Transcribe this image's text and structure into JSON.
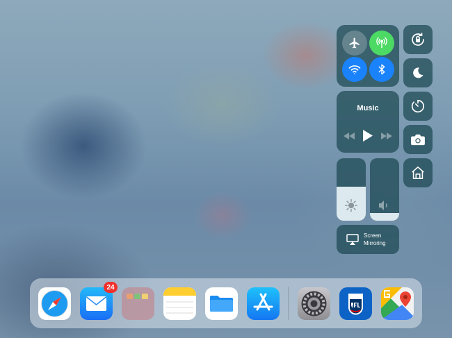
{
  "control_center": {
    "connectivity": {
      "airplane": {
        "icon": "airplane-icon",
        "state": "off"
      },
      "cellular": {
        "icon": "antenna-icon",
        "state": "on",
        "color": "#4cd964"
      },
      "wifi": {
        "icon": "wifi-icon",
        "state": "on",
        "color": "#1a82fb"
      },
      "bluetooth": {
        "icon": "bluetooth-icon",
        "state": "on",
        "color": "#1a82fb"
      }
    },
    "music": {
      "title": "Music",
      "controls": [
        "rewind-icon",
        "play-icon",
        "fast-forward-icon"
      ]
    },
    "brightness": {
      "icon": "sun-icon",
      "level": 0.55
    },
    "volume": {
      "icon": "speaker-icon",
      "level": 0.12
    },
    "screen_mirroring": {
      "label_line1": "Screen",
      "label_line2": "Mirroring",
      "icon": "airplay-icon"
    },
    "side_buttons": [
      {
        "name": "rotation-lock",
        "icon": "rotation-lock-icon"
      },
      {
        "name": "do-not-disturb",
        "icon": "moon-icon"
      },
      {
        "name": "timer",
        "icon": "timer-icon"
      },
      {
        "name": "camera",
        "icon": "camera-icon"
      },
      {
        "name": "home",
        "icon": "home-icon"
      }
    ]
  },
  "dock": {
    "apps": [
      {
        "name": "Safari",
        "icon": "safari-icon"
      },
      {
        "name": "Mail",
        "icon": "mail-icon",
        "badge": "24"
      },
      {
        "name": "Folder",
        "icon": "folder-icon"
      },
      {
        "name": "Notes",
        "icon": "notes-icon"
      },
      {
        "name": "Files",
        "icon": "files-icon"
      },
      {
        "name": "App Store",
        "icon": "app-store-icon"
      },
      {
        "name": "Settings",
        "icon": "settings-icon"
      },
      {
        "name": "NFL",
        "icon": "nfl-icon"
      },
      {
        "name": "Google Maps",
        "icon": "google-maps-icon"
      }
    ]
  }
}
